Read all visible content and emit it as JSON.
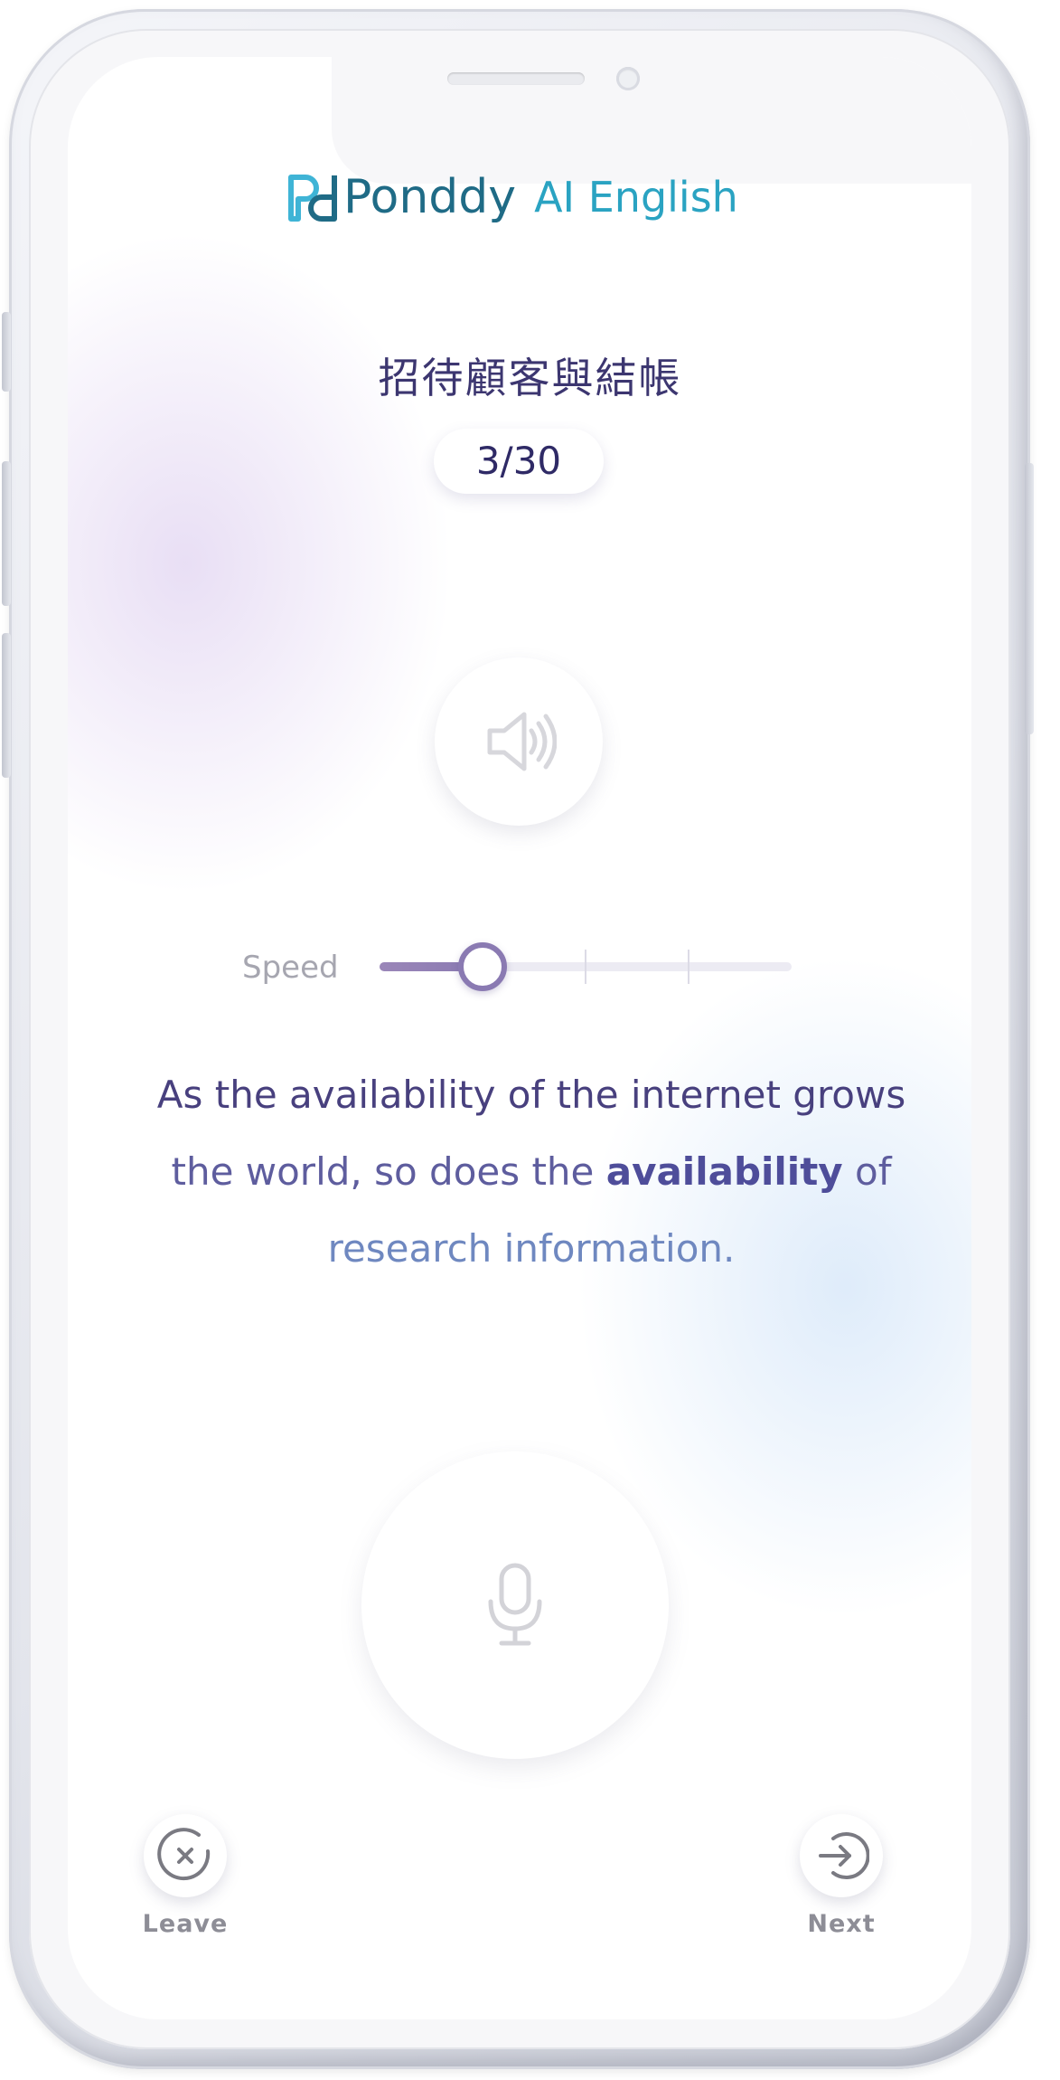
{
  "app": {
    "logo_word": "Ponddy",
    "logo_sub": "AI English"
  },
  "lesson": {
    "title": "招待顧客與結帳",
    "counter": "3/30"
  },
  "controls": {
    "audio_icon": "speaker-icon",
    "speed_label": "Speed",
    "speed_level": 0.25,
    "speed_ticks": [
      0.25,
      0.5,
      0.75
    ],
    "mic_icon": "microphone-icon"
  },
  "sentence": {
    "line1": "As the availability of the internet grows",
    "line2_before": "the world, so does the",
    "line2_highlight": "availability",
    "line2_after": "of",
    "line3": "research information."
  },
  "actions": {
    "leave_label": "Leave",
    "leave_icon": "close-circle-icon",
    "next_label": "Next",
    "next_icon": "sign-in-arrow-icon"
  },
  "colors": {
    "brand_dark": "#1f6b86",
    "brand_light": "#2aa3c2",
    "accent": "#8a7ab2",
    "text": "#48407e"
  }
}
